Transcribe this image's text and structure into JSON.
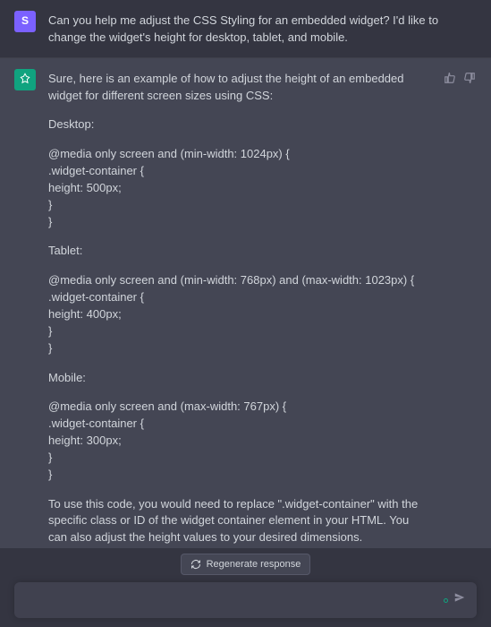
{
  "user": {
    "avatar_letter": "S",
    "message": "Can you help me adjust the CSS Styling for an embedded widget? I'd like to change the widget's height for desktop, tablet, and mobile."
  },
  "assistant": {
    "intro": "Sure, here is an example of how to adjust the height of an embedded widget for different screen sizes using CSS:",
    "desktop_label": "Desktop:",
    "desktop_code": {
      "l1": "@media only screen and (min-width: 1024px) {",
      "l2": ".widget-container {",
      "l3": "height: 500px;",
      "l4": "}",
      "l5": "}"
    },
    "tablet_label": "Tablet:",
    "tablet_code": {
      "l1": "@media only screen and (min-width: 768px) and (max-width: 1023px) {",
      "l2": ".widget-container {",
      "l3": "height: 400px;",
      "l4": "}",
      "l5": "}"
    },
    "mobile_label": "Mobile:",
    "mobile_code": {
      "l1": "@media only screen and (max-width: 767px) {",
      "l2": ".widget-container {",
      "l3": "height: 300px;",
      "l4": "}",
      "l5": "}"
    },
    "outro": "To use this code, you would need to replace \".widget-container\" with the specific class or ID of the widget container element in your HTML. You can also adjust the height values to your desired dimensions."
  },
  "controls": {
    "regenerate_label": "Regenerate response",
    "input_placeholder": ""
  }
}
